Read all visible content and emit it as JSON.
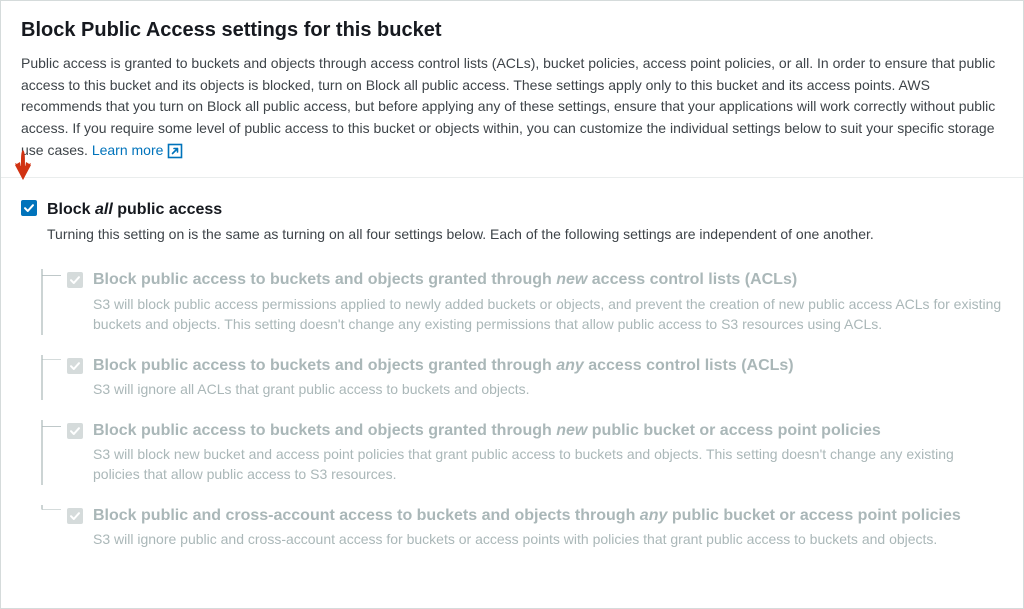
{
  "header": {
    "title": "Block Public Access settings for this bucket",
    "description": "Public access is granted to buckets and objects through access control lists (ACLs), bucket policies, access point policies, or all. In order to ensure that public access to this bucket and its objects is blocked, turn on Block all public access. These settings apply only to this bucket and its access points. AWS recommends that you turn on Block all public access, but before applying any of these settings, ensure that your applications will work correctly without public access. If you require some level of public access to this bucket or objects within, you can customize the individual settings below to suit your specific storage use cases. ",
    "learn_more": "Learn more"
  },
  "main": {
    "label_pre": "Block ",
    "label_em": "all",
    "label_post": " public access",
    "sub": "Turning this setting on is the same as turning on all four settings below. Each of the following settings are independent of one another."
  },
  "items": [
    {
      "pre": "Block public access to buckets and objects granted through ",
      "em": "new",
      "post": " access control lists (ACLs)",
      "desc": "S3 will block public access permissions applied to newly added buckets or objects, and prevent the creation of new public access ACLs for existing buckets and objects. This setting doesn't change any existing permissions that allow public access to S3 resources using ACLs."
    },
    {
      "pre": "Block public access to buckets and objects granted through ",
      "em": "any",
      "post": " access control lists (ACLs)",
      "desc": "S3 will ignore all ACLs that grant public access to buckets and objects."
    },
    {
      "pre": "Block public access to buckets and objects granted through ",
      "em": "new",
      "post": " public bucket or access point policies",
      "desc": "S3 will block new bucket and access point policies that grant public access to buckets and objects. This setting doesn't change any existing policies that allow public access to S3 resources."
    },
    {
      "pre": "Block public and cross-account access to buckets and objects through ",
      "em": "any",
      "post": " public bucket or access point policies",
      "desc": "S3 will ignore public and cross-account access for buckets or access points with policies that grant public access to buckets and objects."
    }
  ]
}
